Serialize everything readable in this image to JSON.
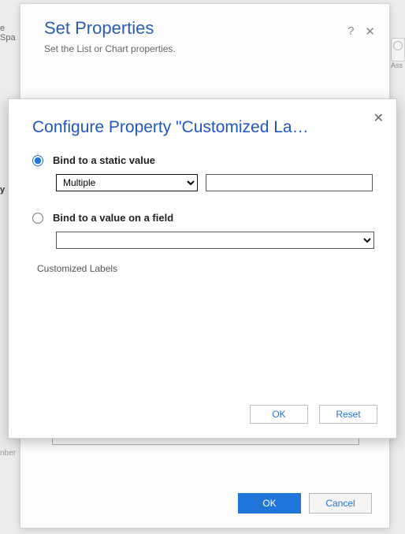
{
  "bg": {
    "spa_label": "e Spa",
    "assist_label": "Ass",
    "nber": "nber",
    "y": "y"
  },
  "outer": {
    "title": "Set Properties",
    "subtitle": "Set the List or Chart properties.",
    "help_icon": "?",
    "close_icon": "✕",
    "star": "*",
    "footer": {
      "ok": "OK",
      "cancel": "Cancel"
    }
  },
  "inner": {
    "title": "Configure Property \"Customized La…",
    "close_icon": "✕",
    "option1": {
      "label": "Bind to a static value",
      "checked": true,
      "select_value": "Multiple",
      "text_value": ""
    },
    "option2": {
      "label": "Bind to a value on a field",
      "checked": false,
      "select_value": ""
    },
    "hint": "Customized Labels",
    "footer": {
      "ok": "OK",
      "reset": "Reset"
    }
  }
}
